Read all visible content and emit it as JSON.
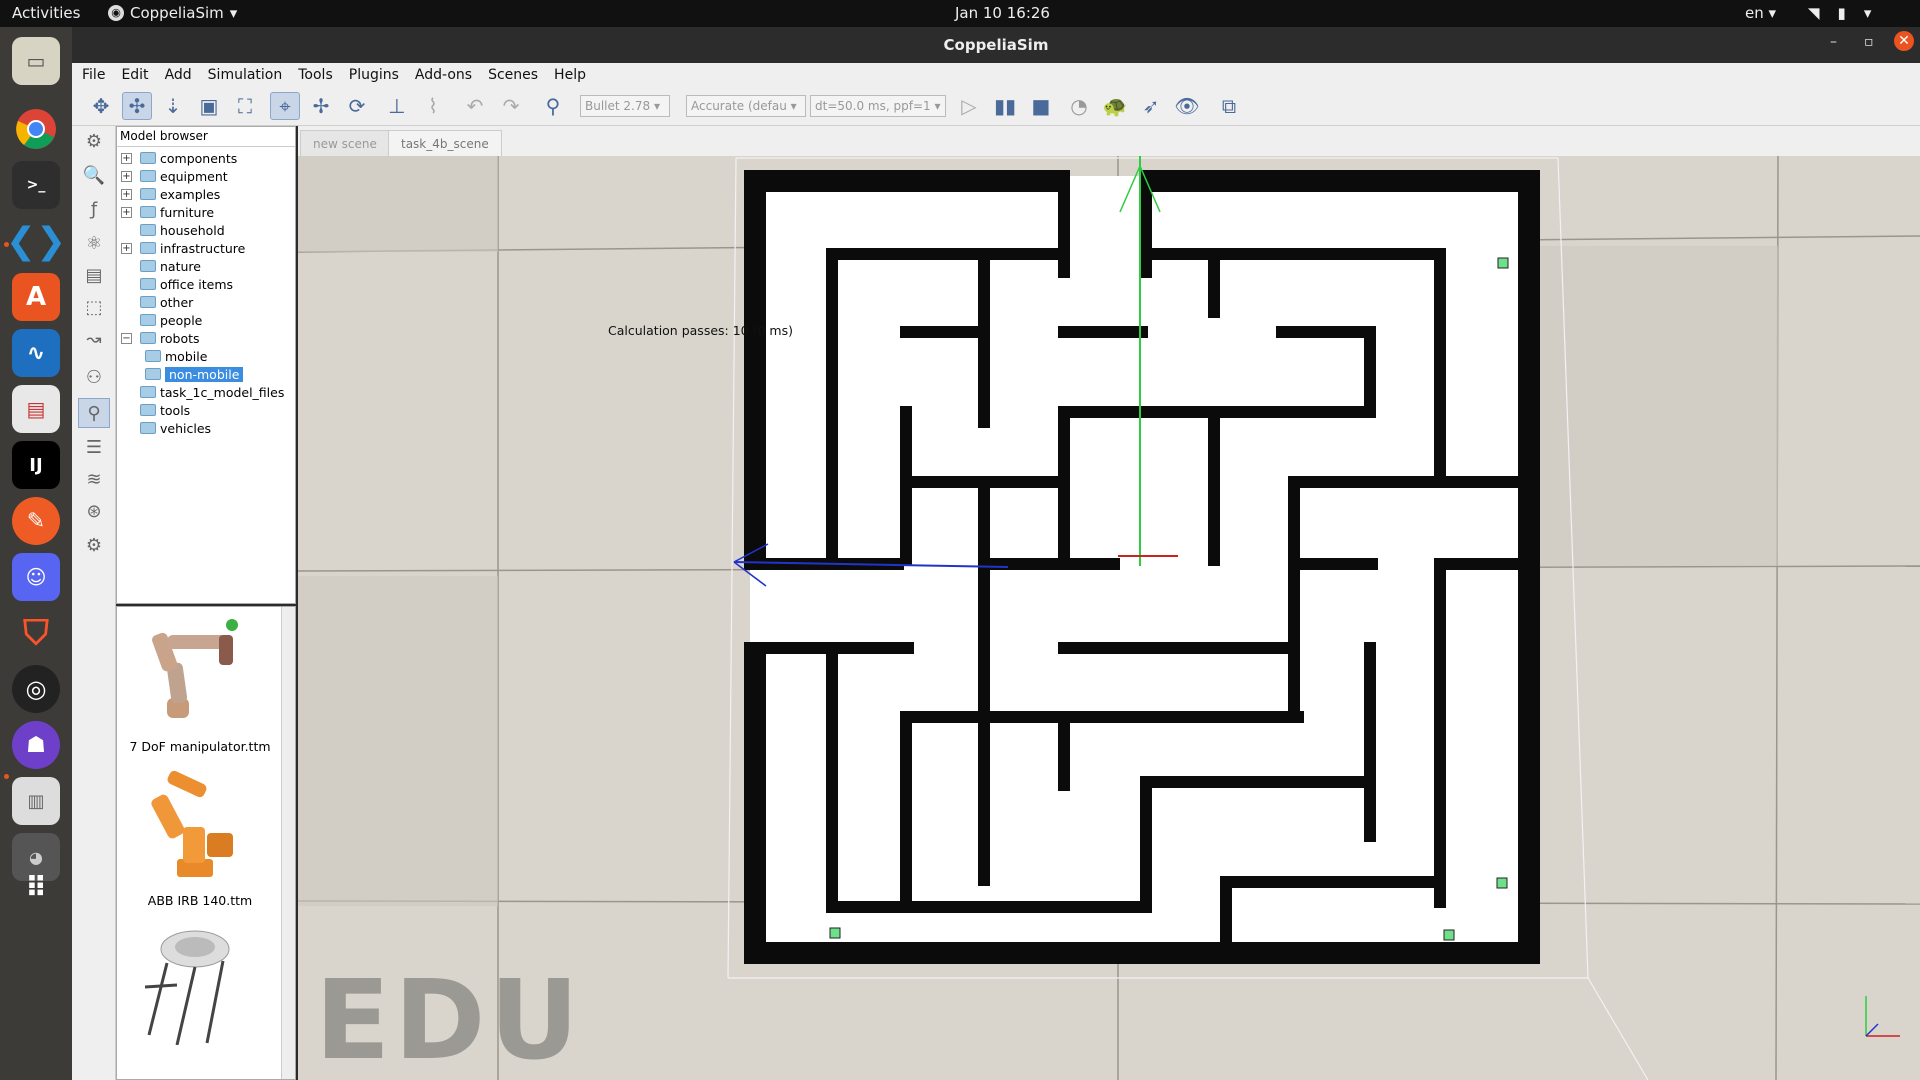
{
  "topbar": {
    "activities": "Activities",
    "app_name": "CoppeliaSim",
    "clock": "Jan 10  16:26",
    "lang": "en"
  },
  "window": {
    "title": "CoppeliaSim"
  },
  "menu": [
    "File",
    "Edit",
    "Add",
    "Simulation",
    "Tools",
    "Plugins",
    "Add-ons",
    "Scenes",
    "Help"
  ],
  "toolbar": {
    "engine": "Bullet 2.78",
    "accuracy": "Accurate (defau",
    "timestep": "dt=50.0 ms, ppf=1"
  },
  "browser": {
    "header": "Model browser",
    "items": [
      {
        "label": "components",
        "expandable": true
      },
      {
        "label": "equipment",
        "expandable": true
      },
      {
        "label": "examples",
        "expandable": true
      },
      {
        "label": "furniture",
        "expandable": true
      },
      {
        "label": "household",
        "expandable": false
      },
      {
        "label": "infrastructure",
        "expandable": true
      },
      {
        "label": "nature",
        "expandable": false
      },
      {
        "label": "office items",
        "expandable": false
      },
      {
        "label": "other",
        "expandable": false
      },
      {
        "label": "people",
        "expandable": false
      },
      {
        "label": "robots",
        "expandable": true,
        "expanded": true
      },
      {
        "label": "mobile",
        "child": true
      },
      {
        "label": "non-mobile",
        "child": true,
        "selected": true
      },
      {
        "label": "task_1c_model_files",
        "expandable": false
      },
      {
        "label": "tools",
        "expandable": false
      },
      {
        "label": "vehicles",
        "expandable": false
      }
    ]
  },
  "thumbnails": [
    {
      "label": "7 DoF manipulator.ttm"
    },
    {
      "label": "ABB IRB 140.ttm"
    }
  ],
  "scene_tabs": [
    "new scene",
    "task_4b_scene"
  ],
  "viewport": {
    "calc_text": "Calculation passes: 10 (0 ms)",
    "watermark": "EDU"
  }
}
